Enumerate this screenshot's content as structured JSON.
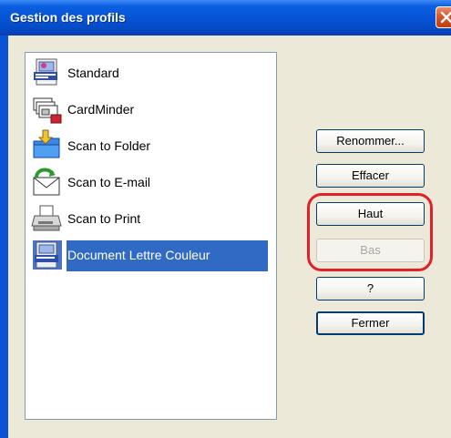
{
  "window": {
    "title": "Gestion des profils"
  },
  "profiles": [
    {
      "label": "Standard",
      "icon": "scansnap-organizer-icon"
    },
    {
      "label": "CardMinder",
      "icon": "cardminder-icon"
    },
    {
      "label": "Scan to Folder",
      "icon": "folder-icon"
    },
    {
      "label": "Scan to E-mail",
      "icon": "email-icon"
    },
    {
      "label": "Scan to Print",
      "icon": "printer-icon"
    },
    {
      "label": "Document Lettre Couleur",
      "icon": "document-profile-icon",
      "selected": true
    }
  ],
  "buttons": {
    "rename": "Renommer...",
    "delete": "Effacer",
    "up": "Haut",
    "down": "Bas",
    "help": "?",
    "close": "Fermer"
  },
  "colors": {
    "title_bar": "#0553d4",
    "selection": "#316ac5",
    "highlight_outline": "#e0202a",
    "disabled_text": "#aca899"
  }
}
